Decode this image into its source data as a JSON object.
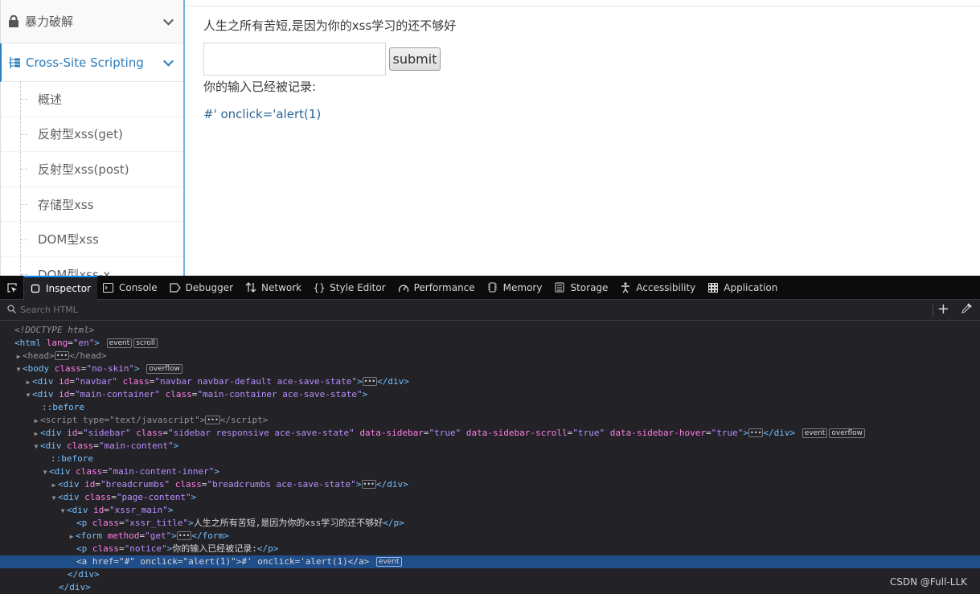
{
  "sidebar": {
    "brute": {
      "label": "暴力破解",
      "icon": "lock-icon"
    },
    "xss": {
      "label": "Cross-Site Scripting",
      "icon": "tree-list-icon",
      "color": "#2b7dbc"
    },
    "items": [
      "概述",
      "反射型xss(get)",
      "反射型xss(post)",
      "存储型xss",
      "DOM型xss",
      "DOM型xss-x"
    ]
  },
  "main": {
    "title": "人生之所有苦短,是因为你的xss学习的还不够好",
    "submit_label": "submit",
    "input_value": "",
    "notice": "你的输入已经被记录:",
    "link_text": "#' onclick='alert(1)"
  },
  "devtools": {
    "tabs": [
      "Inspector",
      "Console",
      "Debugger",
      "Network",
      "Style Editor",
      "Performance",
      "Memory",
      "Storage",
      "Accessibility",
      "Application"
    ],
    "search_placeholder": "Search HTML",
    "tree": {
      "doctype": "<!DOCTYPE html>",
      "html_tag": "html",
      "html_lang": "\"en\"",
      "head_tag": "head",
      "body_class": "\"no-skin\"",
      "navbar_id": "\"navbar\"",
      "navbar_class": "\"navbar navbar-default ace-save-state\"",
      "main_id": "\"main-container\"",
      "main_class": "\"main-container ace-save-state\"",
      "before": "::before",
      "script_type": "\"text/javascript\"",
      "sidebar_id": "\"sidebar\"",
      "sidebar_class": "\"sidebar responsive ace-save-state\"",
      "sidebar_attr1": "\"true\"",
      "sidebar_attr2": "\"true\"",
      "sidebar_attr3": "\"true\"",
      "content_class": "\"main-content\"",
      "inner_class": "\"main-content-inner\"",
      "bc_id": "\"breadcrumbs\"",
      "bc_class": "\"breadcrumbs ace-save-state\"",
      "pc_class": "\"page-content\"",
      "xm_id": "\"xssr_main\"",
      "p1_class": "\"xssr_title\"",
      "p1_text": "人生之所有苦短,是因为你的xss学习的还不够好",
      "form_method": "\"get\"",
      "p2_class": "\"notice\"",
      "p2_text": "你的输入已经被记录:",
      "a_href": "\"#\"",
      "a_onclick": "\"alert(1)\"",
      "a_text": "#' onclick='alert(1)"
    },
    "badges": {
      "event": "event",
      "scroll": "scroll",
      "overflow": "overflow"
    }
  },
  "watermark": "CSDN @Full-LLK"
}
